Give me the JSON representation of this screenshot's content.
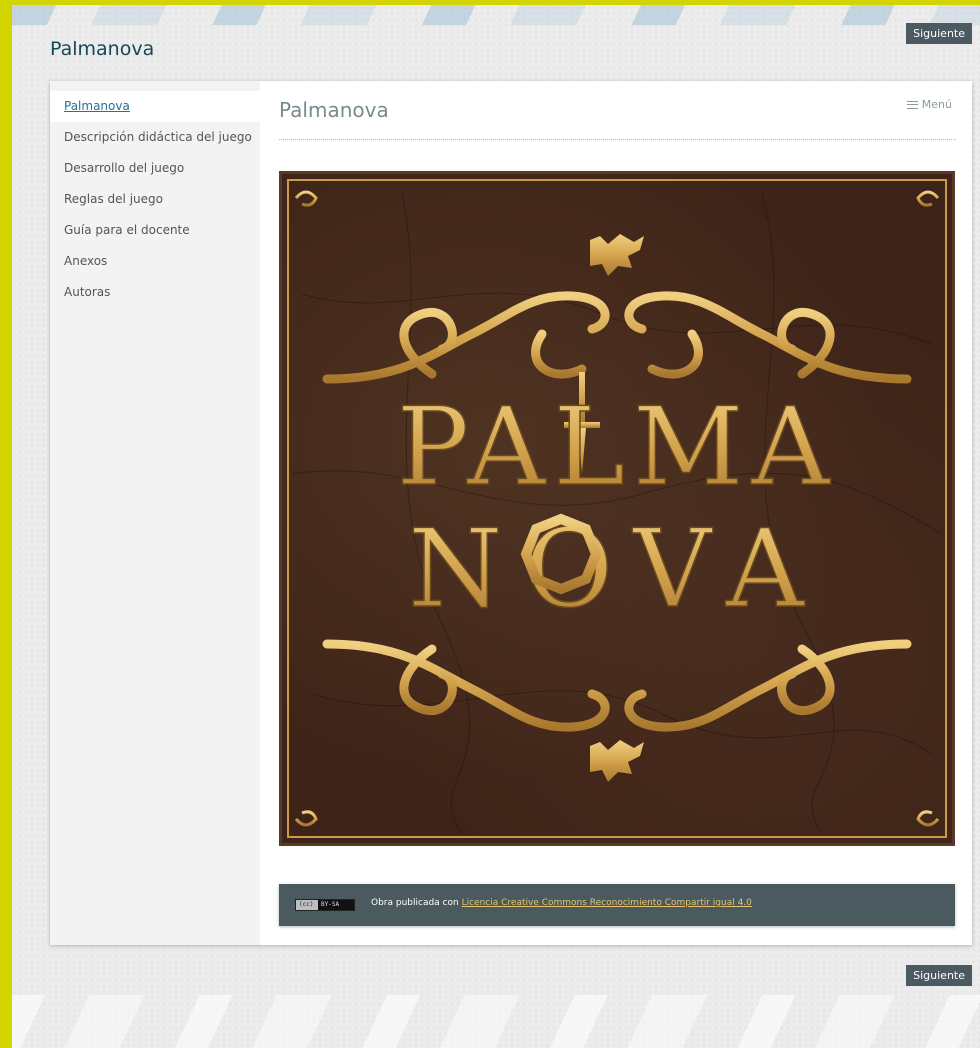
{
  "site": {
    "title": "Palmanova"
  },
  "nav": {
    "next_label": "Siguiente"
  },
  "sidebar": {
    "items": [
      {
        "label": "Palmanova"
      },
      {
        "label": "Descripción didáctica del juego"
      },
      {
        "label": "Desarrollo del juego"
      },
      {
        "label": "Reglas del juego"
      },
      {
        "label": "Guía para el docente"
      },
      {
        "label": "Anexos"
      },
      {
        "label": "Autoras"
      }
    ],
    "active_index": 0
  },
  "page": {
    "title": "Palmanova",
    "menu_label": "Menú",
    "cover": {
      "title_line1": "PALMA",
      "title_line2": "NOVA",
      "palette": {
        "background": "#3e2418",
        "gold": "#c89a4a"
      }
    }
  },
  "license": {
    "badge_left": "(cc)",
    "badge_right": "BY-SA",
    "text": "Obra publicada con",
    "link": "Licencia Creative Commons Reconocimiento Compartir igual 4.0"
  },
  "colors": {
    "accent_yellow": "#d4d400",
    "button_bg": "#4a5a60",
    "link_blue": "#2a6e9b"
  }
}
